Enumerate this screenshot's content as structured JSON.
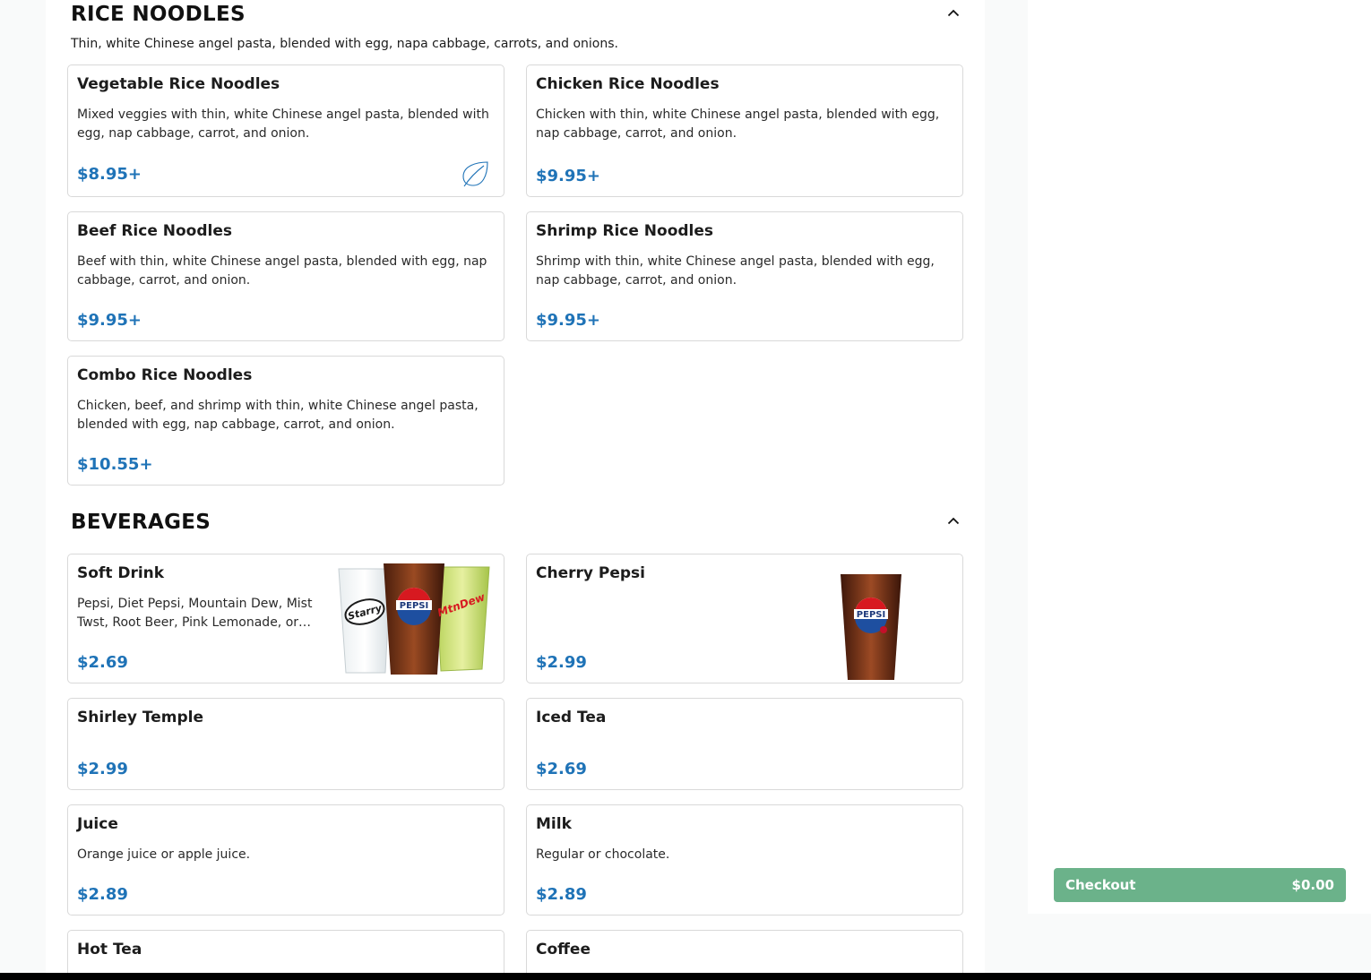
{
  "rice_noodles": {
    "title": "RICE NOODLES",
    "description": "Thin, white Chinese angel pasta, blended with egg, napa cabbage, carrots, and onions.",
    "items": [
      {
        "name": "Vegetable Rice Noodles",
        "description": "Mixed veggies with thin, white Chinese angel pasta, blended with egg, nap cabbage, carrot, and onion.",
        "price": "$8.95+",
        "icon": "leaf-icon"
      },
      {
        "name": "Chicken Rice Noodles",
        "description": "Chicken with thin, white Chinese angel pasta, blended with egg, nap cabbage, carrot, and onion.",
        "price": "$9.95+"
      },
      {
        "name": "Beef Rice Noodles",
        "description": "Beef with thin, white Chinese angel pasta, blended with egg, nap cabbage, carrot, and onion.",
        "price": "$9.95+"
      },
      {
        "name": "Shrimp Rice Noodles",
        "description": "Shrimp with thin, white Chinese angel pasta, blended with egg, nap cabbage, carrot, and onion.",
        "price": "$9.95+"
      },
      {
        "name": "Combo Rice Noodles",
        "description": "Chicken, beef, and shrimp with thin, white Chinese angel pasta, blended with egg, nap cabbage, carrot, and onion.",
        "price": "$10.55+"
      }
    ]
  },
  "beverages": {
    "title": "BEVERAGES",
    "items": [
      {
        "name": "Soft Drink",
        "description": "Pepsi, Diet Pepsi, Mountain Dew, Mist Twst, Root Beer, Pink Lemonade, or…",
        "price": "$2.69",
        "image_logos": [
          "Starry",
          "PEPSI",
          "Mtn Dew"
        ]
      },
      {
        "name": "Cherry Pepsi",
        "price": "$2.99",
        "image_logos": [
          "PEPSI"
        ]
      },
      {
        "name": "Shirley Temple",
        "price": "$2.99"
      },
      {
        "name": "Iced Tea",
        "price": "$2.69"
      },
      {
        "name": "Juice",
        "description": "Orange juice or apple juice.",
        "price": "$2.89"
      },
      {
        "name": "Milk",
        "description": "Regular or chocolate.",
        "price": "$2.89"
      },
      {
        "name": "Hot Tea"
      },
      {
        "name": "Coffee"
      }
    ]
  },
  "checkout": {
    "label": "Checkout",
    "total": "$0.00"
  },
  "colors": {
    "price": "#1f73b7",
    "checkout": "#6bb28a",
    "leaf": "#1f73b7"
  }
}
